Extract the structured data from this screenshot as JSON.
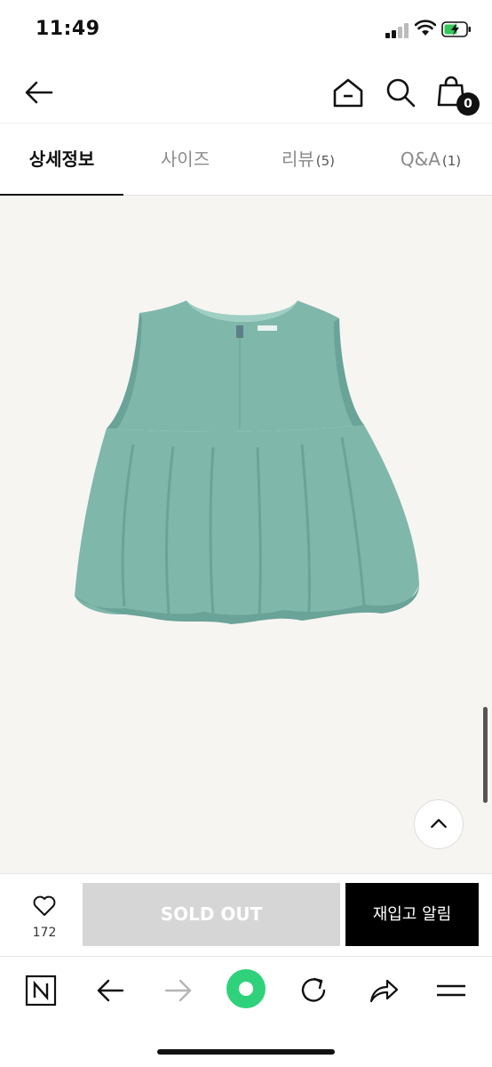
{
  "status_bar": {
    "time": "11:49"
  },
  "header": {
    "cart_count": "0"
  },
  "tabs": [
    {
      "label": "상세정보",
      "count": ""
    },
    {
      "label": "사이즈",
      "count": ""
    },
    {
      "label": "리뷰",
      "count": "(5)"
    },
    {
      "label": "Q&A",
      "count": "(1)"
    }
  ],
  "product": {
    "image_colors": {
      "garment": "#7fb7ab",
      "shade": "#6aa397",
      "bg": "#f6f5f2"
    }
  },
  "purchase": {
    "like_count": "172",
    "soldout_label": "SOLD OUT",
    "restock_label": "재입고 알림"
  },
  "browser": {
    "icons": [
      "naver-n-icon",
      "back-arrow-icon",
      "forward-arrow-icon",
      "green-dot-icon",
      "refresh-icon",
      "share-icon",
      "menu-icon"
    ]
  },
  "colors": {
    "accent_green": "#2fd27a",
    "black": "#000000"
  }
}
